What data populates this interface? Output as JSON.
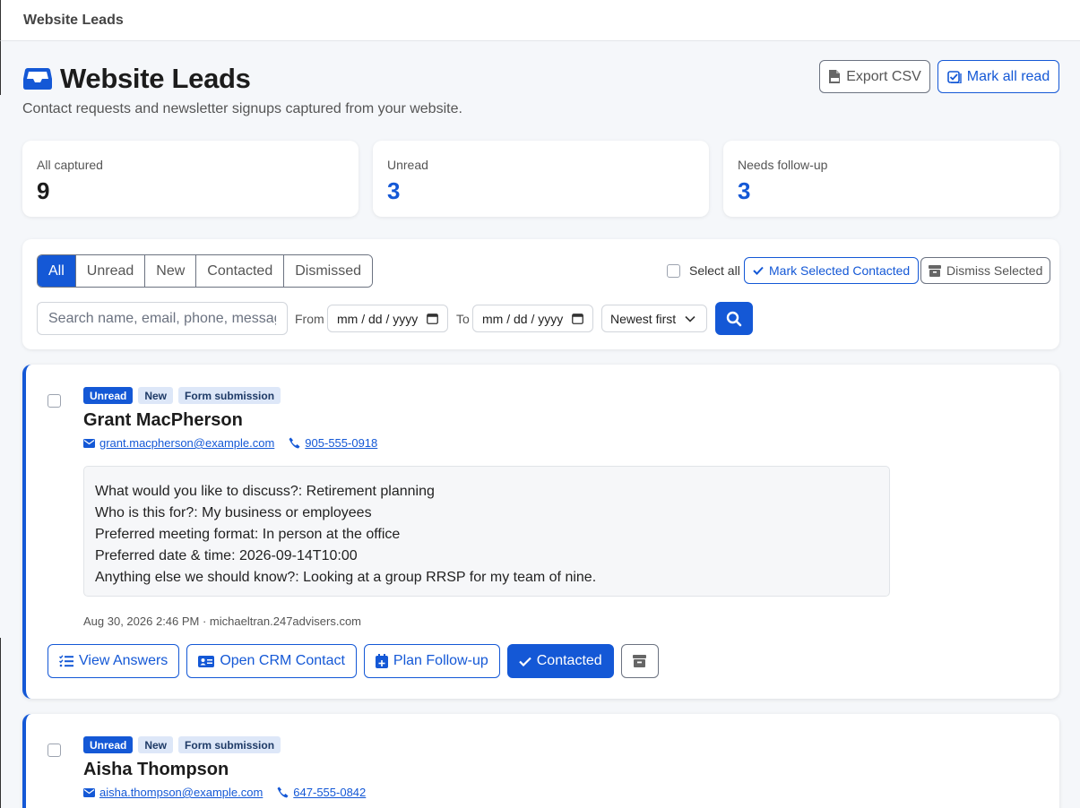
{
  "app": {
    "title": "Website Leads"
  },
  "header": {
    "title": "Website Leads",
    "subtitle": "Contact requests and newsletter signups captured from your website.",
    "export_label": "Export CSV",
    "mark_all_read_label": "Mark all read"
  },
  "stats": [
    {
      "label": "All captured",
      "value": "9"
    },
    {
      "label": "Unread",
      "value": "3"
    },
    {
      "label": "Needs follow-up",
      "value": "3"
    }
  ],
  "filters": {
    "tabs": [
      "All",
      "Unread",
      "New",
      "Contacted",
      "Dismissed"
    ],
    "active_tab": "All",
    "select_all_label": "Select all",
    "mark_selected_label": "Mark Selected Contacted",
    "dismiss_selected_label": "Dismiss Selected",
    "search_placeholder": "Search name, email, phone, message",
    "from_label": "From",
    "to_label": "To",
    "date_placeholder": "mm / dd / yyyy",
    "sort_value": "Newest first"
  },
  "leads": [
    {
      "badges": [
        "Unread",
        "New",
        "Form submission"
      ],
      "name": "Grant MacPherson",
      "email": "grant.macpherson@example.com",
      "phone": "905-555-0918",
      "message_lines": [
        "What would you like to discuss?: Retirement planning",
        "Who is this for?: My business or employees",
        "Preferred meeting format: In person at the office",
        "Preferred date & time: 2026-09-14T10:00",
        "Anything else we should know?: Looking at a group RRSP for my team of nine."
      ],
      "meta": "Aug 30, 2026 2:46 PM · michaeltran.247advisers.com",
      "actions": {
        "view": "View Answers",
        "crm": "Open CRM Contact",
        "plan": "Plan Follow-up",
        "contacted": "Contacted"
      }
    },
    {
      "badges": [
        "Unread",
        "New",
        "Form submission"
      ],
      "name": "Aisha Thompson",
      "email": "aisha.thompson@example.com",
      "phone": "647-555-0842"
    }
  ],
  "colors": {
    "accent": "#1458d6",
    "badge_light": "#dde7f8"
  }
}
